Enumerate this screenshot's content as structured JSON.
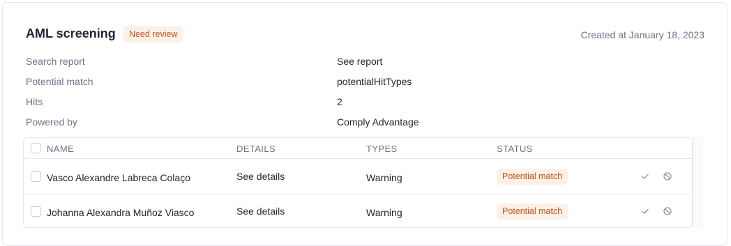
{
  "header": {
    "title": "AML screening",
    "status_badge": "Need review",
    "created_at": "Created at January 18, 2023"
  },
  "details": [
    {
      "label": "Search report",
      "value": "See report"
    },
    {
      "label": "Potential match",
      "value": "potentialHitTypes"
    },
    {
      "label": "Hits",
      "value": "2"
    },
    {
      "label": "Powered by",
      "value": "Comply Advantage"
    }
  ],
  "table": {
    "columns": [
      "NAME",
      "DETAILS",
      "TYPES",
      "STATUS"
    ],
    "rows": [
      {
        "name": "Vasco Alexandre Labreca Colaço",
        "details": "See details",
        "type": "Warning",
        "status": "Potential match"
      },
      {
        "name": "Johanna Alexandra Muñoz Viasco",
        "details": "See details",
        "type": "Warning",
        "status": "Potential match"
      }
    ]
  },
  "icons": {
    "approve": "check-icon",
    "dismiss": "block-icon"
  },
  "colors": {
    "badge_bg": "#fdf1e7",
    "badge_text": "#c2561a",
    "muted_text": "#6b7588"
  }
}
